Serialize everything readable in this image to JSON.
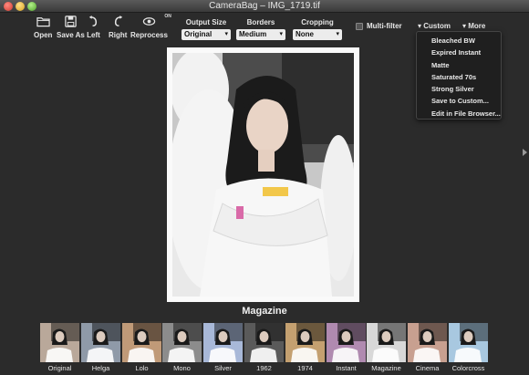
{
  "window": {
    "title": "CameraBag – IMG_1719.tif"
  },
  "toolbar": {
    "open": "Open",
    "save_as": "Save As",
    "left": "Left",
    "right": "Right",
    "reprocess": "Reprocess",
    "on_badge": "ON",
    "output_size": {
      "label": "Output Size",
      "value": "Original"
    },
    "borders": {
      "label": "Borders",
      "value": "Medium"
    },
    "cropping": {
      "label": "Cropping",
      "value": "None"
    },
    "multi_filter": "Multi-filter",
    "custom": "Custom",
    "more": "More"
  },
  "custom_menu": {
    "items": [
      "Bleached BW",
      "Expired Instant",
      "Matte",
      "Saturated 70s",
      "Strong Silver",
      "Save to Custom...",
      "Edit in File Browser..."
    ]
  },
  "main": {
    "current_filter": "Magazine"
  },
  "filmstrip": {
    "items": [
      {
        "label": "Original",
        "tint": "#b9a89a"
      },
      {
        "label": "Helga",
        "tint": "#8f9aa8"
      },
      {
        "label": "Lolo",
        "tint": "#c09a78"
      },
      {
        "label": "Mono",
        "tint": "#8c8c8c"
      },
      {
        "label": "Silver",
        "tint": "#a8b8d8"
      },
      {
        "label": "1962",
        "tint": "#5a5a5a"
      },
      {
        "label": "1974",
        "tint": "#c4a070"
      },
      {
        "label": "Instant",
        "tint": "#b08ab0"
      },
      {
        "label": "Magazine",
        "tint": "#d8d8d8"
      },
      {
        "label": "Cinema",
        "tint": "#c8a090"
      },
      {
        "label": "Colorcross",
        "tint": "#a8c8e0"
      }
    ]
  }
}
